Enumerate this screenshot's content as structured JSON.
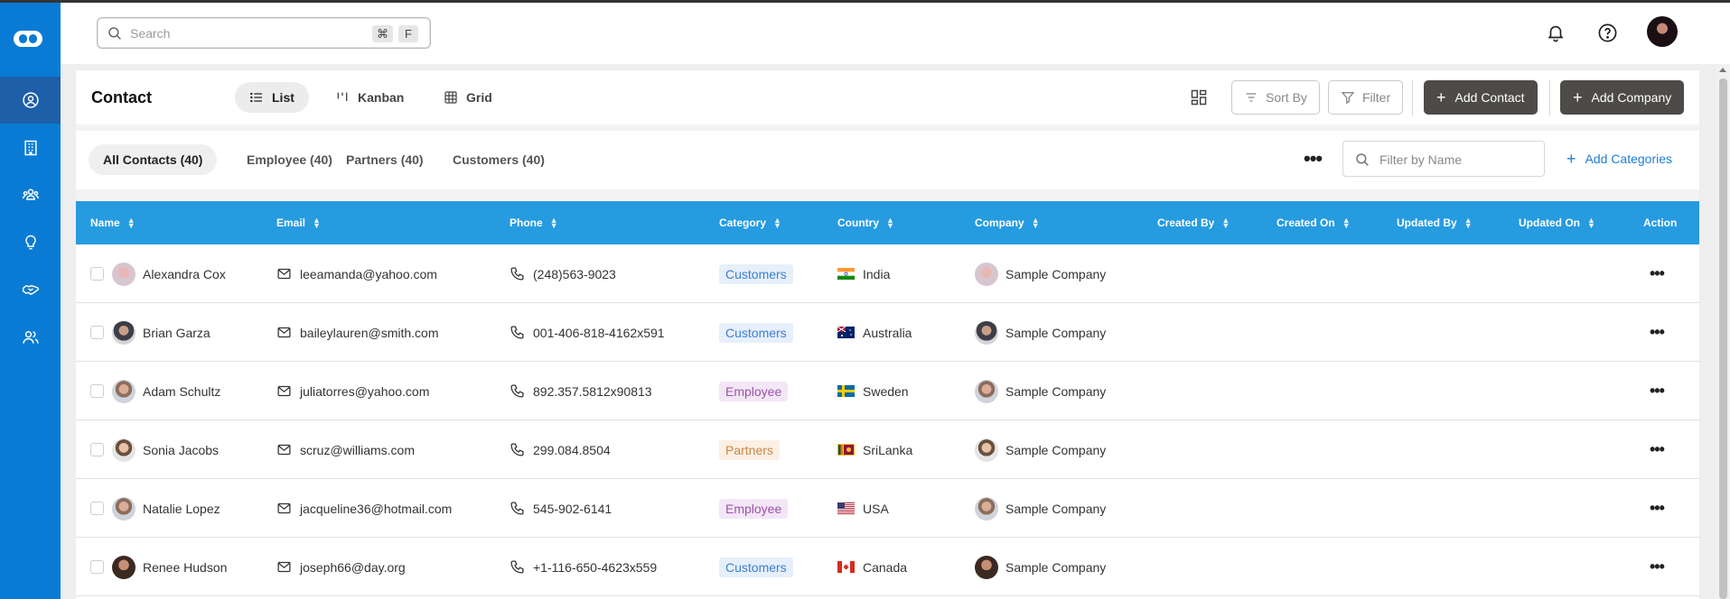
{
  "app": {
    "logo_name": "logo-icon"
  },
  "sidebar": {
    "items": [
      {
        "name": "contacts",
        "icon": "user-circle-icon",
        "active": true
      },
      {
        "name": "companies",
        "icon": "building-icon",
        "active": false
      },
      {
        "name": "groups",
        "icon": "group-icon",
        "active": false
      },
      {
        "name": "ideas",
        "icon": "lightbulb-icon",
        "active": false
      },
      {
        "name": "deals",
        "icon": "handshake-icon",
        "active": false
      },
      {
        "name": "users",
        "icon": "users-icon",
        "active": false
      }
    ]
  },
  "header": {
    "search": {
      "placeholder": "Search",
      "shortcut_cmd": "⌘",
      "shortcut_key": "F"
    }
  },
  "toolbar": {
    "title": "Contact",
    "views": [
      {
        "label": "List",
        "active": true
      },
      {
        "label": "Kanban",
        "active": false
      },
      {
        "label": "Grid",
        "active": false
      }
    ],
    "sort_label": "Sort By",
    "filter_label": "Filter",
    "add_contact_label": "Add Contact",
    "add_company_label": "Add Company"
  },
  "categories": {
    "tabs": [
      {
        "label": "All Contacts (40)",
        "active": true
      },
      {
        "label": "Employee (40)",
        "active": false
      },
      {
        "label": "Partners (40)",
        "active": false
      },
      {
        "label": "Customers (40)",
        "active": false
      }
    ],
    "filter_placeholder": "Filter by Name",
    "add_categories_label": "Add Categories"
  },
  "table": {
    "columns": [
      "Name",
      "Email",
      "Phone",
      "Category",
      "Country",
      "Company",
      "Created By",
      "Created On",
      "Updated By",
      "Updated On",
      "Action"
    ],
    "rows": [
      {
        "name": "Alexandra Cox",
        "email": "leeamanda@yahoo.com",
        "phone": "(248)563-9023",
        "category": "Customers",
        "country": "India",
        "company": "Sample Company"
      },
      {
        "name": "Brian Garza",
        "email": "baileylauren@smith.com",
        "phone": "001-406-818-4162x591",
        "category": "Customers",
        "country": "Australia",
        "company": "Sample Company"
      },
      {
        "name": "Adam Schultz",
        "email": "juliatorres@yahoo.com",
        "phone": "892.357.5812x90813",
        "category": "Employee",
        "country": "Sweden",
        "company": "Sample Company"
      },
      {
        "name": "Sonia Jacobs",
        "email": "scruz@williams.com",
        "phone": "299.084.8504",
        "category": "Partners",
        "country": "SriLanka",
        "company": "Sample Company"
      },
      {
        "name": "Natalie Lopez",
        "email": "jacqueline36@hotmail.com",
        "phone": "545-902-6141",
        "category": "Employee",
        "country": "USA",
        "company": "Sample Company"
      },
      {
        "name": "Renee Hudson",
        "email": "joseph66@day.org",
        "phone": "+1-116-650-4623x559",
        "category": "Customers",
        "country": "Canada",
        "company": "Sample Company"
      }
    ]
  },
  "colors": {
    "sidebar": "#0a7bd4",
    "table_header": "#269be0",
    "dark_button": "#4d4b47",
    "link": "#1c7ed6"
  }
}
